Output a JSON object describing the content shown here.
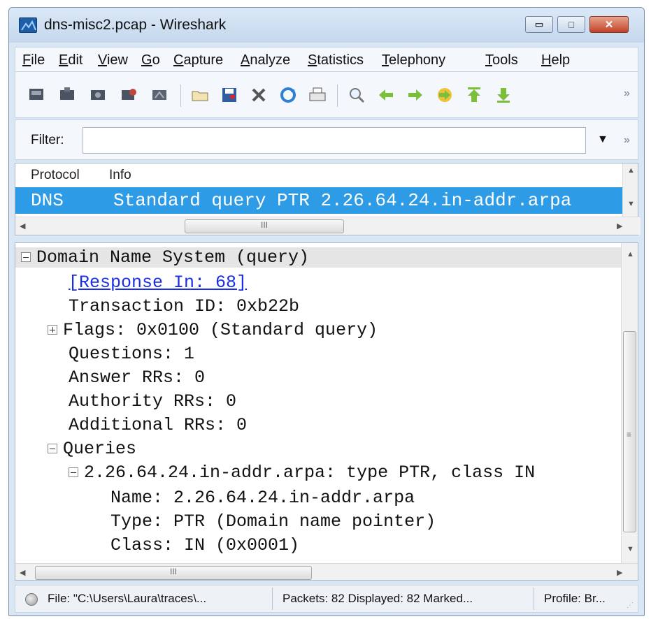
{
  "window": {
    "title": "dns-misc2.pcap - Wireshark",
    "controls": {
      "minimize": "▭",
      "maximize": "□",
      "close": "✕"
    }
  },
  "menu": [
    "File",
    "Edit",
    "View",
    "Go",
    "Capture",
    "Analyze",
    "Statistics",
    "Telephony",
    "Tools",
    "Help"
  ],
  "toolbar": {
    "icons": [
      "interface-list-icon",
      "capture-options-icon",
      "start-capture-icon",
      "stop-capture-icon",
      "restart-capture-icon",
      "open-file-icon",
      "save-file-icon",
      "close-file-icon",
      "reload-icon",
      "print-icon",
      "find-packet-icon",
      "go-back-icon",
      "go-forward-icon",
      "go-to-packet-icon",
      "go-first-icon",
      "go-last-icon"
    ],
    "more": "»"
  },
  "filter": {
    "label": "Filter:",
    "value": "",
    "dropdown": "▼",
    "more": "»"
  },
  "packet_list": {
    "columns": [
      "Protocol",
      "Info"
    ],
    "rows": [
      {
        "protocol": "DNS",
        "info": "Standard query PTR 2.26.64.24.in-addr.arpa"
      }
    ],
    "hscroll_grip": "III"
  },
  "details": {
    "lines": [
      "Domain Name System (query)",
      "[Response In: 68]",
      "Transaction ID: 0xb22b",
      "Flags: 0x0100 (Standard query)",
      "Questions: 1",
      "Answer RRs: 0",
      "Authority RRs: 0",
      "Additional RRs: 0",
      "Queries",
      "2.26.64.24.in-addr.arpa: type PTR, class IN",
      "Name: 2.26.64.24.in-addr.arpa",
      "Type: PTR (Domain name pointer)",
      "Class: IN (0x0001)"
    ],
    "scroll_grip": "≡",
    "hscroll_grip": "III"
  },
  "status": {
    "file": "File: \"C:\\Users\\Laura\\traces\\...",
    "packets": "Packets: 82 Displayed: 82 Marked...",
    "profile": "Profile: Br..."
  },
  "colors": {
    "selected_row": "#2e9be6",
    "link": "#1b2ee6"
  }
}
